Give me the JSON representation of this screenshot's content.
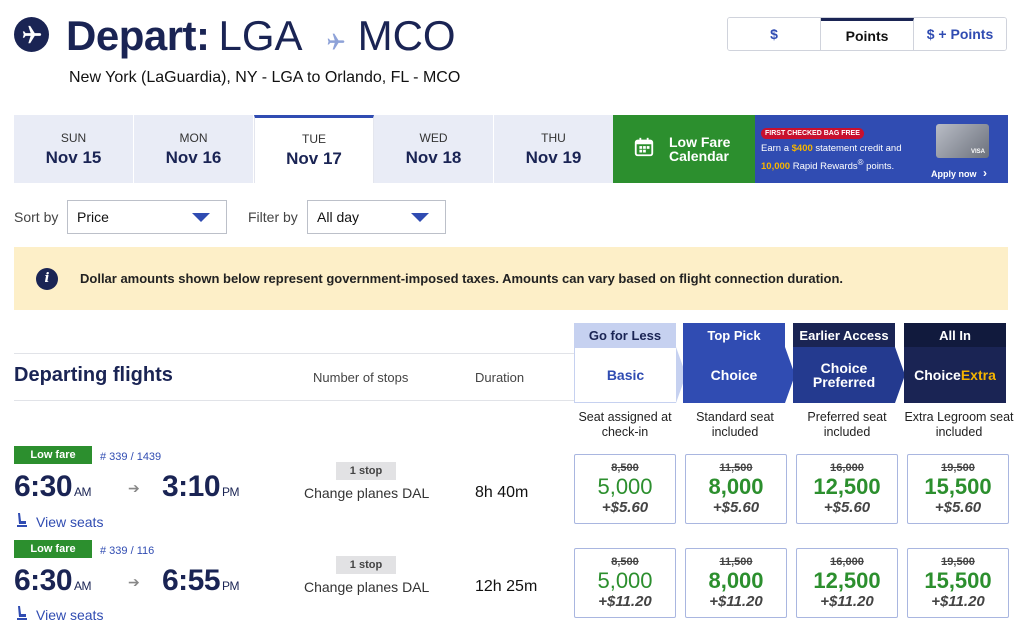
{
  "header": {
    "depart_label": "Depart:",
    "origin": "LGA",
    "destination": "MCO",
    "subtitle": "New York (LaGuardia), NY - LGA to Orlando, FL - MCO"
  },
  "price_toggle": [
    {
      "label": "$",
      "active": false
    },
    {
      "label": "Points",
      "active": true
    },
    {
      "label": "$ + Points",
      "active": false
    }
  ],
  "dates": [
    {
      "dow": "SUN",
      "date": "Nov 15"
    },
    {
      "dow": "MON",
      "date": "Nov 16"
    },
    {
      "dow": "TUE",
      "date": "Nov 17"
    },
    {
      "dow": "WED",
      "date": "Nov 18"
    },
    {
      "dow": "THU",
      "date": "Nov 19"
    }
  ],
  "low_fare_calendar": {
    "line1": "Low Fare",
    "line2": "Calendar"
  },
  "promo": {
    "tag": "FIRST CHECKED BAG FREE",
    "text_1": "Earn a ",
    "amount": "$400",
    "text_2": " statement credit and ",
    "points": "10,000",
    "text_3": " Rapid Rewards",
    "reg": "®",
    "text_4": " points.",
    "apply": "Apply now",
    "card_text": "VISA"
  },
  "sort": {
    "label": "Sort by",
    "value": "Price"
  },
  "filter": {
    "label": "Filter by",
    "value": "All day"
  },
  "notice": {
    "icon": "i",
    "message": "Dollar amounts shown below represent government-imposed taxes. Amounts can vary based on flight connection duration."
  },
  "table": {
    "title": "Departing flights",
    "col_stops": "Number of stops",
    "col_duration": "Duration"
  },
  "fares": [
    {
      "top": "Go for Less",
      "name": "Basic",
      "desc": "Seat assigned at check-in"
    },
    {
      "top": "Top Pick",
      "name": "Choice",
      "desc": "Standard seat included"
    },
    {
      "top": "Earlier Access",
      "name": "Choice Preferred",
      "desc": "Preferred seat included"
    },
    {
      "top": "All In",
      "name_a": "Choice ",
      "name_b": "Extra",
      "desc": "Extra Legroom seat included"
    }
  ],
  "flights": [
    {
      "badge": "Low fare",
      "flight_no": "# 339 / 1439",
      "dep_time": "6:30",
      "dep_ampm": "AM",
      "arr_time": "3:10",
      "arr_ampm": "PM",
      "view_seats": "View seats",
      "stops": "1 stop",
      "change": "Change planes DAL",
      "duration": "8h 40m",
      "prices": [
        {
          "old": "8,500",
          "pts": "5,000",
          "tax": "+$5.60"
        },
        {
          "old": "11,500",
          "pts": "8,000",
          "tax": "+$5.60"
        },
        {
          "old": "16,000",
          "pts": "12,500",
          "tax": "+$5.60"
        },
        {
          "old": "19,500",
          "pts": "15,500",
          "tax": "+$5.60"
        }
      ]
    },
    {
      "badge": "Low fare",
      "flight_no": "# 339 / 116",
      "dep_time": "6:30",
      "dep_ampm": "AM",
      "arr_time": "6:55",
      "arr_ampm": "PM",
      "view_seats": "View seats",
      "stops": "1 stop",
      "change": "Change planes DAL",
      "duration": "12h 25m",
      "prices": [
        {
          "old": "8,500",
          "pts": "5,000",
          "tax": "+$11.20"
        },
        {
          "old": "11,500",
          "pts": "8,000",
          "tax": "+$11.20"
        },
        {
          "old": "16,000",
          "pts": "12,500",
          "tax": "+$11.20"
        },
        {
          "old": "19,500",
          "pts": "15,500",
          "tax": "+$11.20"
        }
      ]
    }
  ],
  "colors": {
    "navy": "#1a2454",
    "blue": "#304cb2",
    "green": "#2c8f2e",
    "notice": "#fdefc8",
    "gold": "#f5b400"
  }
}
